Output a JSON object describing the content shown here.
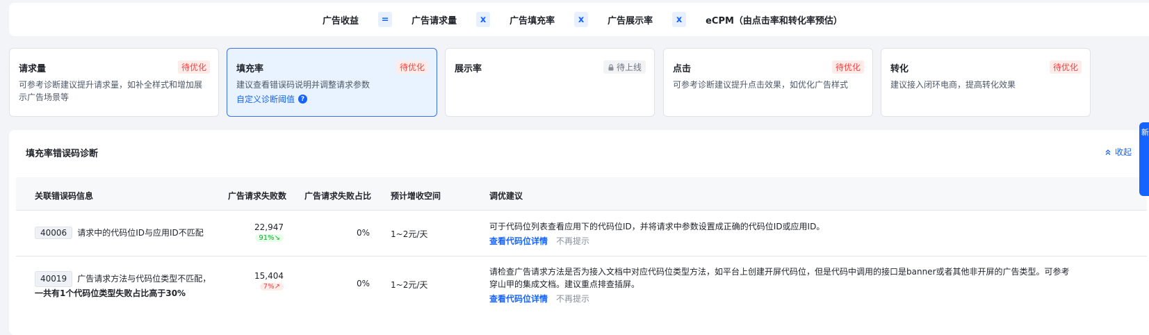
{
  "formula": {
    "terms": [
      "广告收益",
      "广告请求量",
      "广告填充率",
      "广告展示率",
      "eCPM（由点击率和转化率预估）"
    ],
    "ops": [
      "=",
      "x",
      "x",
      "x"
    ]
  },
  "cards": [
    {
      "title": "请求量",
      "badge": "待优化",
      "desc": "可参考诊断建议提升请求量，如补全样式和增加展示广告场景等"
    },
    {
      "title": "填充率",
      "badge": "待优化",
      "desc": "建议查看错误码说明并调整请求参数",
      "link": "自定义诊断阈值"
    },
    {
      "title": "展示率",
      "badge": "待上线",
      "desc": ""
    },
    {
      "title": "点击",
      "badge": "待优化",
      "desc": "可参考诊断建议提升点击效果，如优化广告样式"
    },
    {
      "title": "转化",
      "badge": "待优化",
      "desc": "建议接入闭环电商，提高转化效果"
    }
  ],
  "panel": {
    "title": "填充率错误码诊断",
    "collapse_label": "收起",
    "columns": [
      "关联错误码信息",
      "广告请求失败数",
      "广告请求失败占比",
      "预计增收空间",
      "调优建议"
    ],
    "rows": [
      {
        "code": "40006",
        "message": "请求中的代码位ID与应用ID不匹配",
        "message_extra": "",
        "fail_count": "22,947",
        "trend": "91%↘",
        "fail_ratio": "0%",
        "gain": "1~2元/天",
        "advice": "可于代码位列表查看应用下的代码位ID，并将请求中参数设置成正确的代码位ID或应用ID。",
        "action": "查看代码位详情",
        "dismiss": "不再提示"
      },
      {
        "code": "40019",
        "message": "广告请求方法与代码位类型不匹配，",
        "message_extra": "一共有1个代码位类型失败占比高于30%",
        "fail_count": "15,404",
        "trend": "7%↗",
        "fail_ratio": "0%",
        "gain": "1~2元/天",
        "advice": "请检查广告请求方法是否为接入文档中对应代码位类型方法，如平台上创建开屏代码位，但是代码中调用的接口是banner或者其他非开屏的广告类型。可参考穿山甲的集成文档。建议重点排查插屏。",
        "action": "查看代码位详情",
        "dismiss": "不再提示"
      }
    ]
  },
  "float_tab": "新"
}
